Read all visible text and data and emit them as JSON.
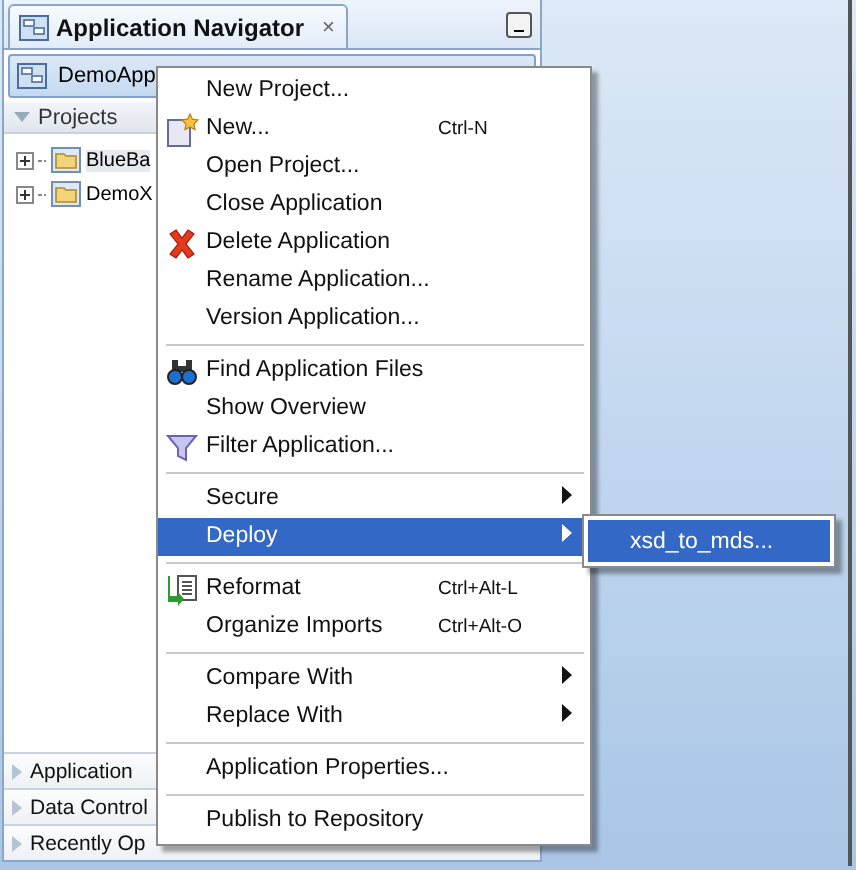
{
  "navigator": {
    "title": "Application Navigator",
    "close": "×",
    "application": "DemoApp",
    "projects_header": "Projects",
    "tree": [
      {
        "label": "BlueBa",
        "expanded": false
      },
      {
        "label": "DemoX",
        "expanded": false
      }
    ],
    "sections": [
      {
        "label": "Application",
        "expanded": false
      },
      {
        "label": "Data Control",
        "expanded": false
      },
      {
        "label": "Recently Op",
        "expanded": false
      }
    ]
  },
  "context_menu": {
    "items": [
      {
        "kind": "item",
        "label": "New Project..."
      },
      {
        "kind": "item",
        "label": "New...",
        "shortcut": "Ctrl-N"
      },
      {
        "kind": "item",
        "label": "Open Project..."
      },
      {
        "kind": "item",
        "label": "Close Application"
      },
      {
        "kind": "item",
        "label": "Delete Application"
      },
      {
        "kind": "item",
        "label": "Rename Application..."
      },
      {
        "kind": "item",
        "label": "Version Application..."
      },
      {
        "kind": "separator"
      },
      {
        "kind": "item",
        "label": "Find Application Files"
      },
      {
        "kind": "item",
        "label": "Show Overview"
      },
      {
        "kind": "item",
        "label": "Filter Application..."
      },
      {
        "kind": "separator"
      },
      {
        "kind": "item",
        "label": "Secure",
        "submenu": true
      },
      {
        "kind": "item",
        "label": "Deploy",
        "submenu": true,
        "selected": true
      },
      {
        "kind": "separator"
      },
      {
        "kind": "item",
        "label": "Reformat",
        "shortcut": "Ctrl+Alt-L"
      },
      {
        "kind": "item",
        "label": "Organize Imports",
        "shortcut": "Ctrl+Alt-O"
      },
      {
        "kind": "separator"
      },
      {
        "kind": "item",
        "label": "Compare With",
        "submenu": true
      },
      {
        "kind": "item",
        "label": "Replace With",
        "submenu": true
      },
      {
        "kind": "separator"
      },
      {
        "kind": "item",
        "label": "Application Properties..."
      },
      {
        "kind": "separator"
      },
      {
        "kind": "item",
        "label": "Publish to Repository"
      }
    ]
  },
  "submenu": {
    "items": [
      {
        "label": "xsd_to_mds...",
        "selected": true
      }
    ]
  }
}
